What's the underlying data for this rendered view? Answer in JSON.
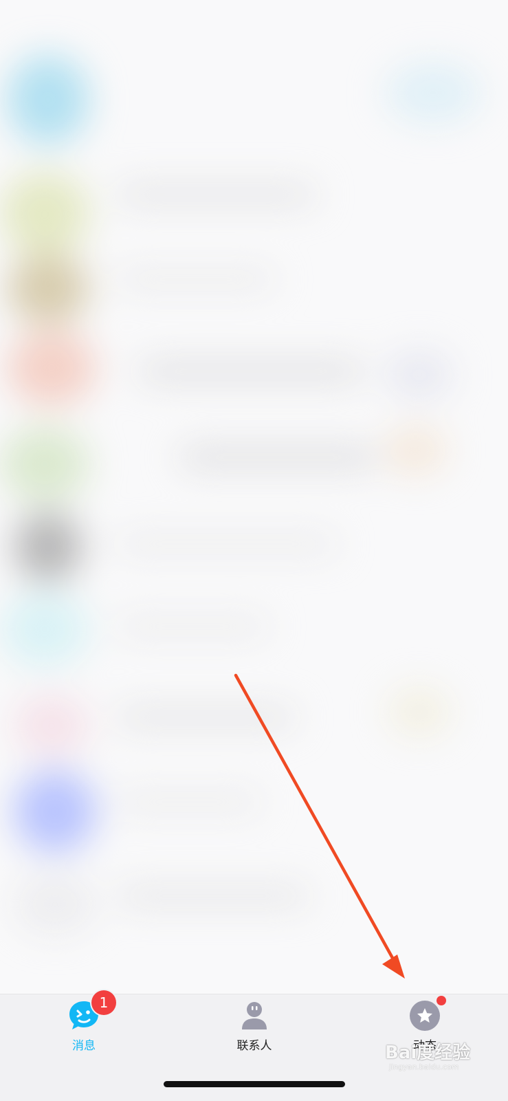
{
  "tabbar": {
    "tabs": [
      {
        "label": "消息",
        "badge": "1",
        "icon": "chat-bubble-icon",
        "active": true
      },
      {
        "label": "联系人",
        "icon": "contacts-person-icon",
        "active": false
      },
      {
        "label": "动态",
        "icon": "star-icon",
        "active": false,
        "has_dot": true
      }
    ]
  },
  "watermark": {
    "main": "Bai度经验",
    "sub": "jingyan.baidu.com"
  },
  "colors": {
    "accent": "#12b7f5",
    "badge": "#f23f3f",
    "arrow": "#f04a23",
    "icon_gray": "#9a9aaa"
  }
}
